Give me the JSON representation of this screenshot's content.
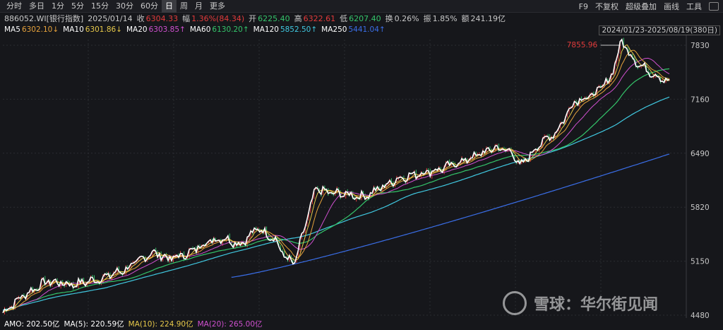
{
  "toolbar": {
    "tabs": [
      "分时",
      "多日",
      "1分",
      "5分",
      "15分",
      "30分",
      "60分",
      "日",
      "周",
      "月",
      "更多"
    ],
    "active_tab": "日",
    "right": [
      "F9",
      "不复权",
      "超级叠加",
      "画线",
      "工具"
    ]
  },
  "info": {
    "code": "886052.WI[银行指数]",
    "date": "2025/01/14",
    "close_label": "收",
    "close": "6304.33",
    "change_label": "幅",
    "change": "1.36%(84.34)",
    "open_label": "开",
    "open": "6225.40",
    "high_label": "高",
    "high": "6322.61",
    "low_label": "低",
    "low": "6207.40",
    "turnover_label": "换",
    "turnover": "0.26%",
    "amplitude_label": "振",
    "amplitude": "1.85%",
    "amount_label": "额",
    "amount": "241.19亿"
  },
  "ma_row": [
    {
      "label": "MA5",
      "value": "6302.10↓",
      "color": "#ffffff",
      "vcolor": "#e6a23c"
    },
    {
      "label": "MA10",
      "value": "6301.86↓",
      "color": "#ffffff",
      "vcolor": "#e6c84a"
    },
    {
      "label": "MA20",
      "value": "6303.85↑",
      "color": "#ffffff",
      "vcolor": "#d050d0"
    },
    {
      "label": "MA60",
      "value": "6130.20↑",
      "color": "#ffffff",
      "vcolor": "#34c46a"
    },
    {
      "label": "MA120",
      "value": "5852.50↑",
      "color": "#ffffff",
      "vcolor": "#40c8e0"
    },
    {
      "label": "MA250",
      "value": "5441.04↑",
      "color": "#ffffff",
      "vcolor": "#3a6ee8"
    }
  ],
  "range_label": "2024/01/23-2025/08/19(380日)",
  "amo_row": [
    {
      "text": "AMO: 202.50亿",
      "color": "#ffffff"
    },
    {
      "text": "MA(5): 220.59亿",
      "color": "#ffffff"
    },
    {
      "text": "MA(10): 224.90亿",
      "color": "#e6c84a"
    },
    {
      "text": "MA(20): 265.00亿",
      "color": "#d050d0"
    }
  ],
  "watermark": "雪球：华尔街见闻",
  "colors": {
    "price": "#ffffff",
    "ma5": "#e6c84a",
    "ma10": "#e6a23c",
    "ma20": "#d050d0",
    "ma60": "#34c46a",
    "ma120": "#40c8e0",
    "ma250": "#3a6ee8",
    "up": "#e23b3b",
    "down": "#34c46a",
    "grid": "#2a2c32"
  },
  "chart_data": {
    "type": "line",
    "y_ticks": [
      7830,
      7160,
      6490,
      5820,
      5150,
      4480
    ],
    "y_tick_labels": [
      "7830",
      "7160",
      "6490",
      "5820",
      "5150",
      "4480"
    ],
    "ylim": [
      4480,
      7900
    ],
    "x_count": 380,
    "annotation": {
      "label": "7855.96",
      "value": 7855.96
    },
    "price_keypoints": [
      [
        0,
        4510
      ],
      [
        10,
        4700
      ],
      [
        25,
        4900
      ],
      [
        40,
        4860
      ],
      [
        55,
        4930
      ],
      [
        70,
        5050
      ],
      [
        85,
        5260
      ],
      [
        95,
        5180
      ],
      [
        105,
        5240
      ],
      [
        115,
        5380
      ],
      [
        125,
        5440
      ],
      [
        135,
        5360
      ],
      [
        145,
        5560
      ],
      [
        155,
        5420
      ],
      [
        160,
        5210
      ],
      [
        166,
        5120
      ],
      [
        172,
        5600
      ],
      [
        178,
        6050
      ],
      [
        185,
        6000
      ],
      [
        195,
        5980
      ],
      [
        205,
        5950
      ],
      [
        215,
        6060
      ],
      [
        225,
        6180
      ],
      [
        235,
        6230
      ],
      [
        250,
        6300
      ],
      [
        265,
        6420
      ],
      [
        280,
        6560
      ],
      [
        290,
        6500
      ],
      [
        294,
        6320
      ],
      [
        305,
        6600
      ],
      [
        315,
        6760
      ],
      [
        325,
        7140
      ],
      [
        335,
        7200
      ],
      [
        345,
        7400
      ],
      [
        352,
        7880
      ],
      [
        360,
        7620
      ],
      [
        368,
        7500
      ],
      [
        378,
        7380
      ]
    ],
    "ma250_start_index": 130,
    "ma250_start_value": 4950,
    "ma250_end_value": 6480,
    "ma120_start_value": 4560,
    "ma120_end_value": 7040,
    "ma60_start_value": 4540,
    "ma60_end_value": 7420
  }
}
